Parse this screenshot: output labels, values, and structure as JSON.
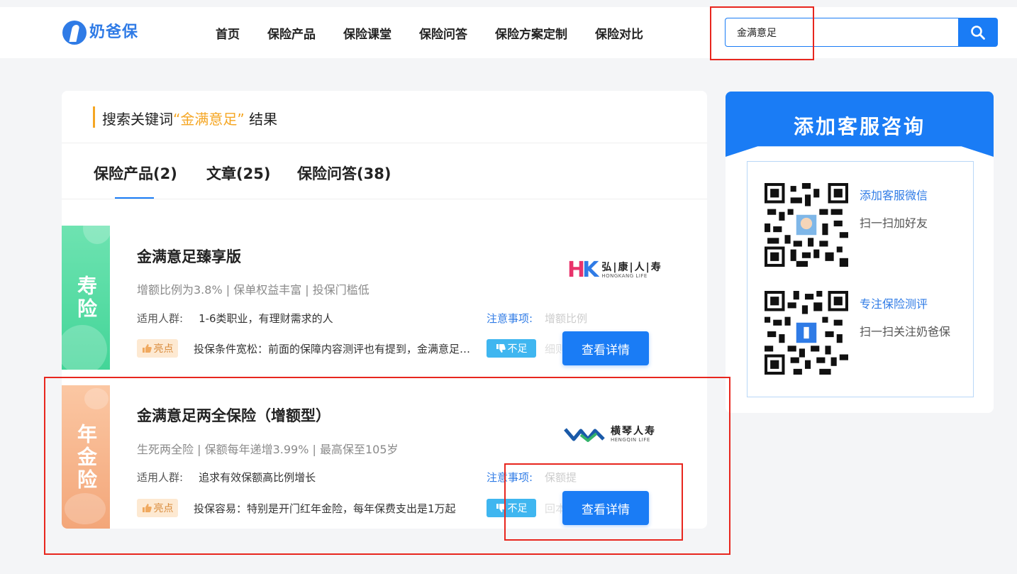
{
  "header": {
    "logo_name": "奶爸保",
    "nav": [
      "首页",
      "保险产品",
      "保险课堂",
      "保险问答",
      "保险方案定制",
      "保险对比"
    ],
    "search_value": "金满意足"
  },
  "results": {
    "title_prefix": "搜索关键词",
    "open_quote": "“",
    "keyword": "金满意足",
    "close_quote": "”",
    "title_suffix": "结果",
    "tabs": [
      "保险产品(2)",
      "文章(25)",
      "保险问答(38)"
    ]
  },
  "products": [
    {
      "tag": "寿险",
      "name": "金满意足臻享版",
      "desc": "增额比例为3.8% | 保单权益丰富 | 投保门槛低",
      "audience_label": "适用人群:",
      "audience": "1-6类职业，有理财需求的人",
      "note_label": "注意事项:",
      "note_fade": "增额比例",
      "good_label": "亮点",
      "good_text": "投保条件宽松：前面的保障内容测评也有提到，金满意足臻享版的投保条件宽松",
      "bad_label": "不足",
      "bad_fade": "细则",
      "button": "查看详情",
      "company_cn": "弘|康|人|寿",
      "company_en": "HONGKANG LIFE",
      "company_color": "#e8336b"
    },
    {
      "tag": "年金险",
      "name": "金满意足两全保险（增额型）",
      "desc": "生死两全险 | 保额每年递增3.99% | 最高保至105岁",
      "audience_label": "适用人群:",
      "audience": "追求有效保额高比例增长",
      "note_label": "注意事项:",
      "note_fade": "保额提",
      "good_label": "亮点",
      "good_text": "投保容易：特别是开门红年金险，每年保费支出是1万起",
      "bad_label": "不足",
      "bad_fade": "回本",
      "button": "查看详情",
      "company_cn": "横琴人寿",
      "company_en": "HENGQIN LIFE",
      "company_color": "#1a5aa8"
    }
  ],
  "sidebar": {
    "title": "添加客服咨询",
    "items": [
      {
        "link": "添加客服微信",
        "sub": "扫一扫加好友"
      },
      {
        "link": "专注保险测评",
        "sub": "扫一扫关注奶爸保"
      }
    ]
  },
  "colors": {
    "primary": "#1a7cf5",
    "accent": "#f5a623",
    "highlight_box": "#e8261e",
    "life_tag": "#43d598",
    "annuity_tag": "#f3a679"
  }
}
